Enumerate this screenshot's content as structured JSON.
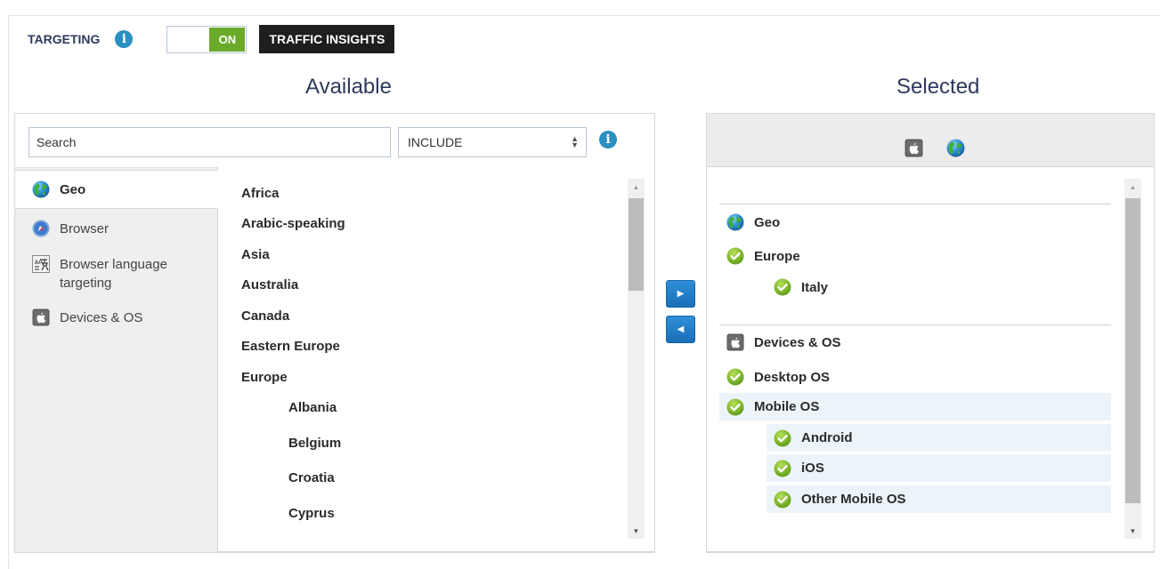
{
  "header": {
    "targeting_label": "TARGETING",
    "toggle_state": "ON",
    "traffic_insights_label": "TRAFFIC INSIGHTS"
  },
  "available": {
    "title": "Available",
    "search": {
      "placeholder": "Search",
      "value": ""
    },
    "mode_select": {
      "selected": "INCLUDE"
    },
    "categories": [
      {
        "label": "Geo",
        "icon": "globe-icon",
        "active": true
      },
      {
        "label": "Browser",
        "icon": "browser-icon",
        "active": false
      },
      {
        "label": "Browser language targeting",
        "icon": "language-icon",
        "active": false
      },
      {
        "label": "Devices & OS",
        "icon": "apple-device-icon",
        "active": false
      }
    ],
    "geo_items": [
      {
        "label": "Africa",
        "level": 0
      },
      {
        "label": "Arabic-speaking",
        "level": 0
      },
      {
        "label": "Asia",
        "level": 0
      },
      {
        "label": "Australia",
        "level": 0
      },
      {
        "label": "Canada",
        "level": 0
      },
      {
        "label": "Eastern Europe",
        "level": 0
      },
      {
        "label": "Europe",
        "level": 0
      },
      {
        "label": "Albania",
        "level": 1
      },
      {
        "label": "Belgium",
        "level": 1
      },
      {
        "label": "Croatia",
        "level": 1
      },
      {
        "label": "Cyprus",
        "level": 1
      }
    ]
  },
  "transfer": {
    "add_icon": "arrow-right-icon",
    "remove_icon": "arrow-left-icon"
  },
  "selected": {
    "title": "Selected",
    "header_icons": [
      "apple-device-icon",
      "globe-icon"
    ],
    "groups": [
      {
        "label": "Geo",
        "icon": "globe-icon",
        "items": [
          {
            "label": "Europe",
            "level": 0,
            "highlighted": false
          },
          {
            "label": "Italy",
            "level": 1,
            "highlighted": false
          }
        ]
      },
      {
        "label": "Devices & OS",
        "icon": "apple-device-icon",
        "items": [
          {
            "label": "Desktop OS",
            "level": 0,
            "highlighted": false
          },
          {
            "label": "Mobile OS",
            "level": 0,
            "highlighted": true
          },
          {
            "label": "Android",
            "level": 1,
            "highlighted": true
          },
          {
            "label": "iOS",
            "level": 1,
            "highlighted": true
          },
          {
            "label": "Other Mobile OS",
            "level": 1,
            "highlighted": true
          }
        ]
      }
    ]
  },
  "colors": {
    "accent_blue": "#2a8fc1",
    "toggle_green": "#6aaa2a",
    "title_navy": "#2d3a5c",
    "highlight_row": "#edf4f9"
  }
}
